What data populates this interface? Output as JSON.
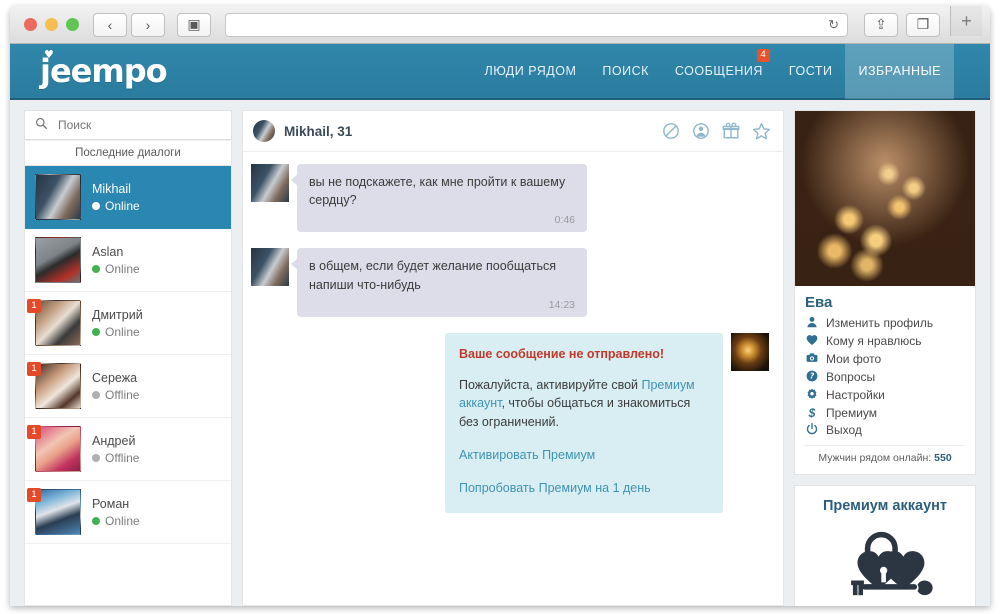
{
  "browser": {
    "url_value": "",
    "url_placeholder": "",
    "back_icon": "‹",
    "forward_icon": "›",
    "sidebar_icon": "▣",
    "reload_icon": "↻",
    "share_icon": "⇪",
    "tabs_icon": "❐",
    "newtab_icon": "+"
  },
  "site": {
    "logo": "jeempo",
    "logo_heart": "♥",
    "nav": [
      {
        "label": "ЛЮДИ РЯДОМ",
        "active": false,
        "badge": ""
      },
      {
        "label": "ПОИСК",
        "active": false,
        "badge": ""
      },
      {
        "label": "СООБЩЕНИЯ",
        "active": false,
        "badge": "4"
      },
      {
        "label": "ГОСТИ",
        "active": false,
        "badge": ""
      },
      {
        "label": "ИЗБРАННЫЕ",
        "active": true,
        "badge": ""
      }
    ],
    "accent_color": "#2f87ab",
    "badge_color": "#e8522a"
  },
  "sidebar": {
    "search_placeholder": "Поиск",
    "search_value": "",
    "search_icon": "search-icon",
    "dialogs_title": "Последние диалоги",
    "contacts": [
      {
        "name": "Mikhail",
        "status": "Online",
        "online": true,
        "unread": "",
        "selected": true
      },
      {
        "name": "Aslan",
        "status": "Online",
        "online": true,
        "unread": "",
        "selected": false
      },
      {
        "name": "Дмитрий",
        "status": "Online",
        "online": true,
        "unread": "1",
        "selected": false
      },
      {
        "name": "Сережа",
        "status": "Offline",
        "online": false,
        "unread": "1",
        "selected": false
      },
      {
        "name": "Андрей",
        "status": "Offline",
        "online": false,
        "unread": "1",
        "selected": false
      },
      {
        "name": "Роман",
        "status": "Online",
        "online": true,
        "unread": "1",
        "selected": false
      }
    ]
  },
  "chat": {
    "peer_name": "Mikhail, 31",
    "actions": [
      "block-icon",
      "profile-icon",
      "gift-icon",
      "favorite-star-icon"
    ],
    "messages": [
      {
        "from": "peer",
        "text": "вы не подскажете, как мне пройти к вашему сердцу?",
        "time": "0:46"
      },
      {
        "from": "peer",
        "text": "в общем, если будет желание пообщаться напиши что-нибудь",
        "time": "14:23"
      }
    ],
    "notice": {
      "error_title": "Ваше сообщение не отправлено!",
      "body_part1": "Пожалуйста, активируйте свой ",
      "body_link": "Премиум аккаунт",
      "body_part2": ", чтобы общаться и знакомиться без ограничений.",
      "action_primary": "Активировать Премиум",
      "action_secondary": "Попробовать Премиум на 1 день"
    }
  },
  "profile": {
    "name": "Ева",
    "menu": [
      {
        "label": "Изменить профиль",
        "icon": "person-icon",
        "glyph": "👤"
      },
      {
        "label": "Кому я нравлюсь",
        "icon": "heart-icon",
        "glyph": "♥"
      },
      {
        "label": "Мои фото",
        "icon": "camera-icon",
        "glyph": "📷"
      },
      {
        "label": "Вопросы",
        "icon": "question-icon",
        "glyph": "?"
      },
      {
        "label": "Настройки",
        "icon": "gear-icon",
        "glyph": "✸"
      },
      {
        "label": "Премиум",
        "icon": "dollar-icon",
        "glyph": "$"
      },
      {
        "label": "Выход",
        "icon": "power-icon",
        "glyph": "⏻"
      }
    ],
    "online_counter_label": "Мужчин рядом онлайн: ",
    "online_counter_value": "550"
  },
  "premium_promo": {
    "title": "Премиум аккаунт",
    "art": "heart-padlock-and-key-icon"
  }
}
